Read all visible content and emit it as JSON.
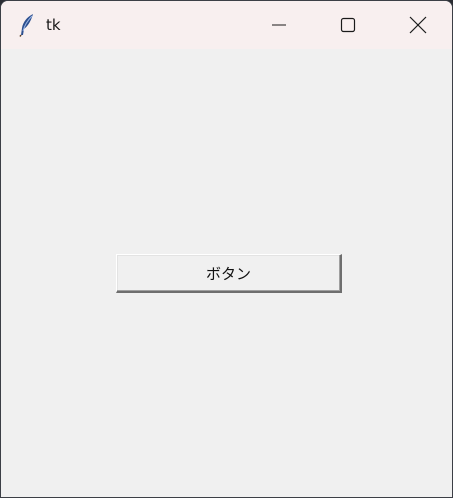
{
  "window": {
    "title": "tk",
    "icon": "feather-icon"
  },
  "controls": {
    "minimize_icon": "minimize-icon",
    "maximize_icon": "maximize-icon",
    "close_icon": "close-icon"
  },
  "main": {
    "button_label": "ボタン"
  },
  "colors": {
    "titlebar_bg": "#f8efef",
    "client_bg": "#f0f0f0"
  }
}
